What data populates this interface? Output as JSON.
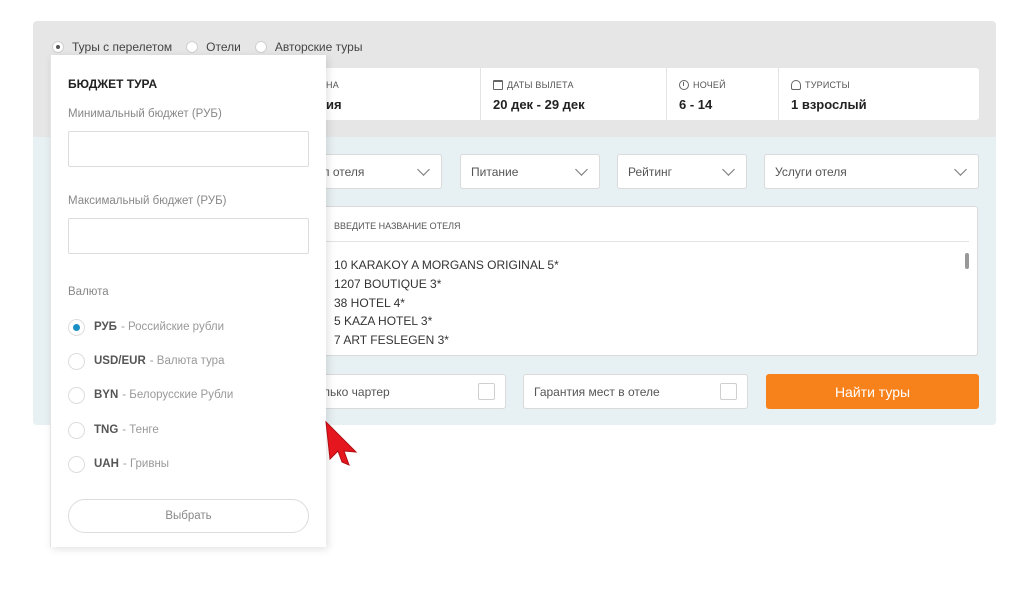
{
  "tour_types": [
    {
      "label": "Туры с перелетом",
      "selected": true
    },
    {
      "label": "Отели",
      "selected": false
    },
    {
      "label": "Авторские туры",
      "selected": false
    }
  ],
  "params": {
    "country": {
      "label": "НА",
      "value": "ия"
    },
    "dates": {
      "label": "ДАТЫ ВЫЛЕТА",
      "value": "20 дек - 29 дек"
    },
    "nights": {
      "label": "НОЧЕЙ",
      "value": "6 - 14"
    },
    "tourists": {
      "label": "ТУРИСТЫ",
      "value": "1 взрослый"
    }
  },
  "filters": {
    "hotel_type": "п отеля",
    "food": "Питание",
    "rating": "Рейтинг",
    "services": "Услуги отеля"
  },
  "hotel_search": {
    "placeholder": "ВВЕДИТЕ НАЗВАНИЕ ОТЕЛЯ",
    "hotels": [
      "10 KARAKOY A MORGANS ORIGINAL 5*",
      "1207 BOUTIQUE 3*",
      "38 HOTEL 4*",
      "5 KAZA HOTEL 3*",
      "7 ART FESLEGEN 3*"
    ]
  },
  "checks": {
    "charter": "лько чартер",
    "guarantee": "Гарантия мест в отеле"
  },
  "find_button": "Найти туры",
  "budget": {
    "title": "БЮДЖЕТ ТУРА",
    "min_label": "Минимальный бюджет (РУБ)",
    "max_label": "Максимальный бюджет (РУБ)",
    "min_value": "",
    "max_value": "",
    "currency_label": "Валюта",
    "currencies": [
      {
        "code": "РУБ",
        "name": "- Российские рубли",
        "selected": true
      },
      {
        "code": "USD/EUR",
        "name": "- Валюта тура",
        "selected": false
      },
      {
        "code": "BYN",
        "name": "- Белорусские Рубли",
        "selected": false
      },
      {
        "code": "TNG",
        "name": "- Тенге",
        "selected": false
      },
      {
        "code": "UAH",
        "name": "- Гривны",
        "selected": false
      }
    ],
    "choose_button": "Выбрать"
  },
  "colors": {
    "accent_orange": "#f7821b",
    "radio_blue": "#1a8fc3",
    "cursor_red": "#e5161d"
  }
}
